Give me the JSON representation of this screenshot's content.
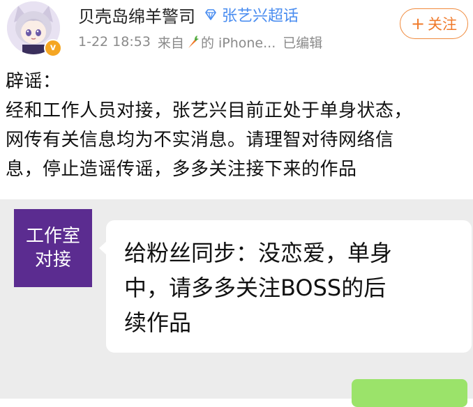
{
  "post": {
    "username": "贝壳岛绵羊警司",
    "supertopic": "张艺兴超话",
    "date_time": "1-22 18:53",
    "source_prefix": "来自",
    "source_suffix": "的 iPhone...",
    "edited": "已编辑",
    "follow_label": "关注",
    "follow_plus": "+",
    "verified_badge": "v",
    "icons": [
      "avatar",
      "verified-badge-icon",
      "diamond-icon",
      "carrot-icon"
    ],
    "text_lines": [
      "辟谣：",
      "经和工作人员对接，张艺兴目前正处于单身状态，",
      "网传有关信息均为不实消息。请理智对待网络信",
      "息，停止造谣传谣，多多关注接下来的作品"
    ]
  },
  "chat": {
    "sender_label_line1": "工作室",
    "sender_label_line2": "对接",
    "message_lines": [
      "给粉丝同步：没恋爱，单身",
      "中，请多多关注BOSS的后",
      "续作品"
    ]
  },
  "colors": {
    "link_blue": "#4a8df0",
    "follow_orange": "#f07a2a",
    "studio_purple": "#5b2c90",
    "chat_bg": "#ececec",
    "reply_green": "#9be36a"
  }
}
